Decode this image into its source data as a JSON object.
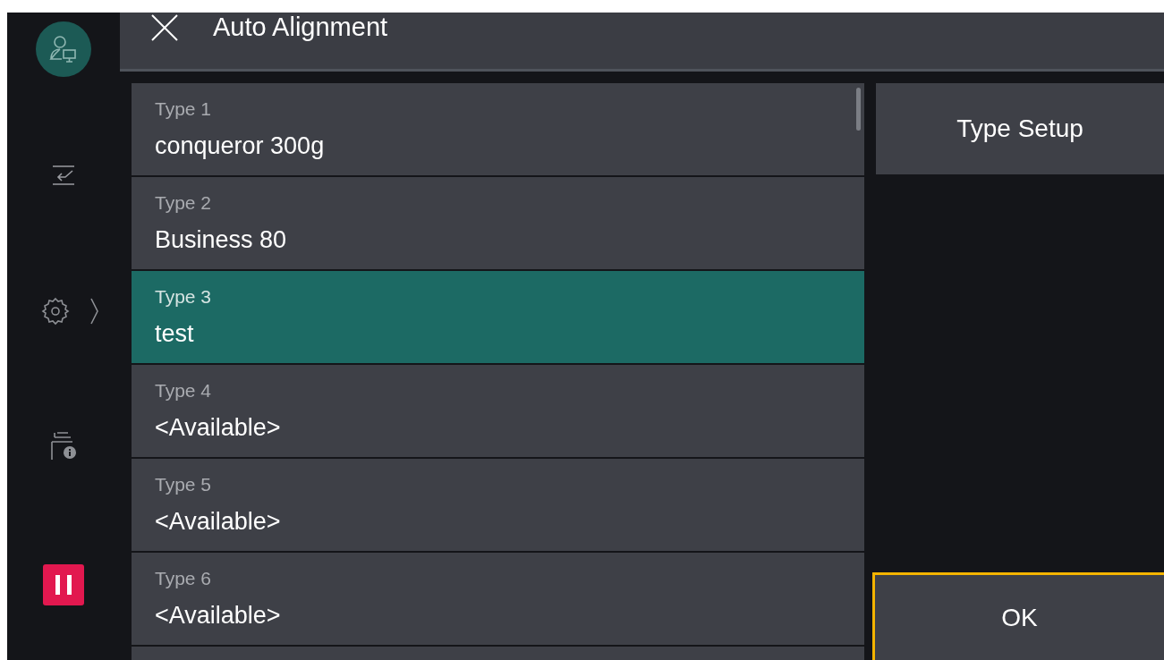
{
  "header": {
    "title": "Auto Alignment"
  },
  "types": [
    {
      "label": "Type 1",
      "value": "conqueror 300g",
      "selected": false
    },
    {
      "label": "Type 2",
      "value": "Business 80",
      "selected": false
    },
    {
      "label": "Type 3",
      "value": "test",
      "selected": true
    },
    {
      "label": "Type 4",
      "value": "<Available>",
      "selected": false
    },
    {
      "label": "Type 5",
      "value": "<Available>",
      "selected": false
    },
    {
      "label": "Type 6",
      "value": "<Available>",
      "selected": false
    }
  ],
  "buttons": {
    "type_setup": "Type Setup",
    "ok": "OK"
  }
}
